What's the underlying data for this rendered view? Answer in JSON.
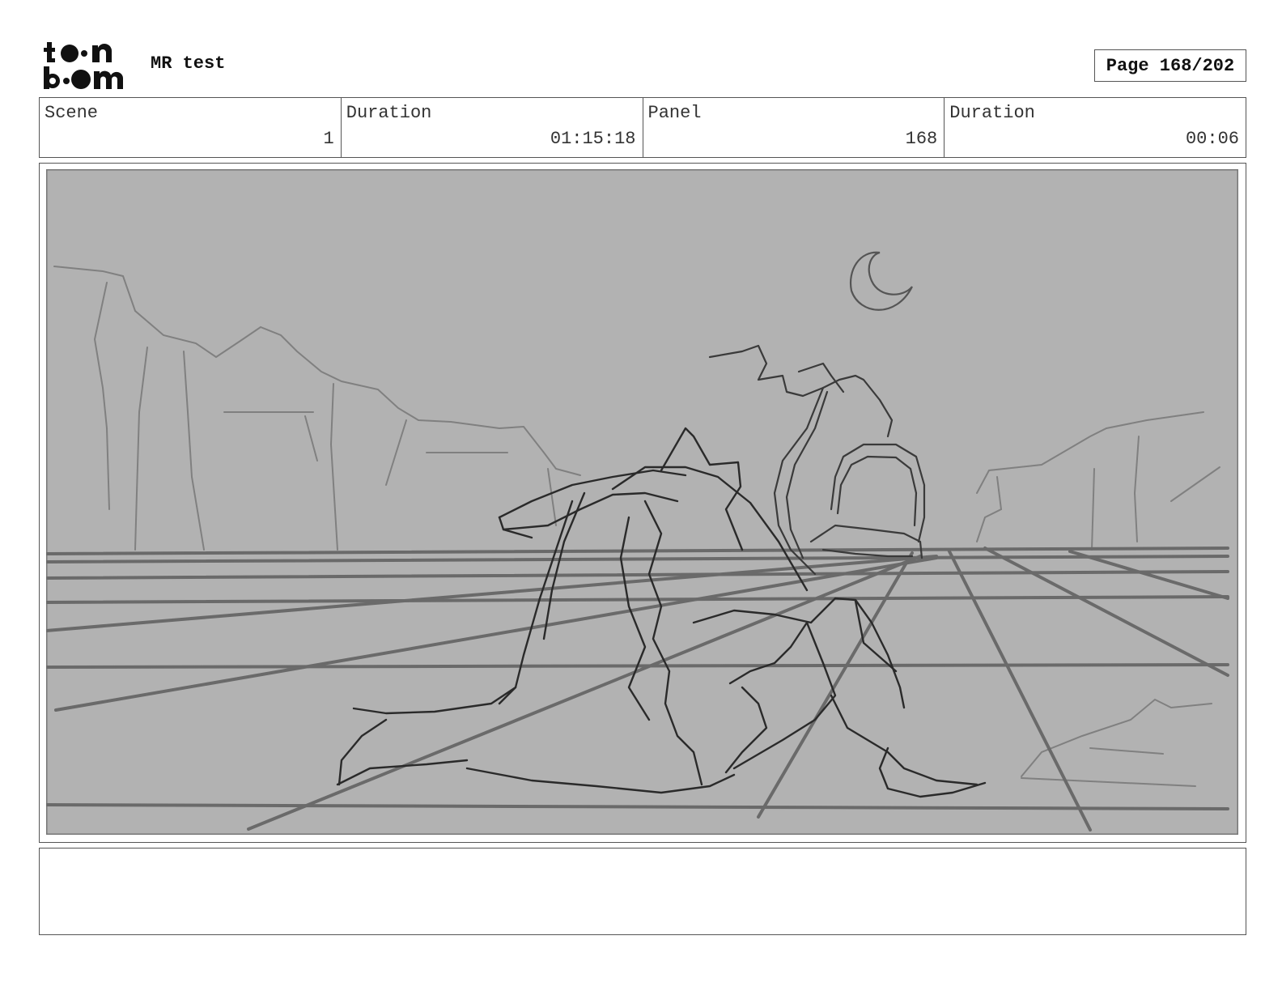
{
  "header": {
    "logo_text": "toonboom",
    "project_title": "MR test",
    "page_label": "Page 168/202"
  },
  "info": [
    {
      "label": "Scene",
      "value": "1"
    },
    {
      "label": "Duration",
      "value": "01:15:18"
    },
    {
      "label": "Panel",
      "value": "168"
    },
    {
      "label": "Duration",
      "value": "00:06"
    }
  ],
  "panel": {
    "background_color": "#b2b2b2",
    "sketch_color": "#2a2a2a",
    "grid_color": "#6a6a6a"
  },
  "notes": {
    "text": ""
  }
}
